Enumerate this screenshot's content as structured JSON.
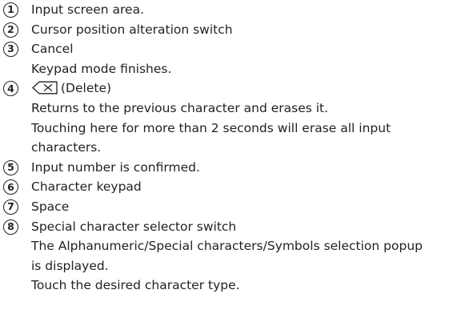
{
  "items": [
    {
      "number": "1",
      "title": "Input screen area."
    },
    {
      "number": "2",
      "title": "Cursor position alteration switch"
    },
    {
      "number": "3",
      "title": "Cancel",
      "desc": [
        "Keypad mode finishes."
      ]
    },
    {
      "number": "4",
      "title": "(Delete)",
      "icon": "delete-backspace-icon",
      "desc": [
        "Returns to the previous character and erases it.",
        "Touching here for more than 2 seconds will erase all input",
        "characters."
      ]
    },
    {
      "number": "5",
      "title": "Input number is confirmed."
    },
    {
      "number": "6",
      "title": "Character keypad"
    },
    {
      "number": "7",
      "title": "Space"
    },
    {
      "number": "8",
      "title": "Special character selector switch",
      "desc": [
        "The Alphanumeric/Special characters/Symbols selection popup",
        "is displayed.",
        "Touch the desired character type."
      ]
    }
  ]
}
